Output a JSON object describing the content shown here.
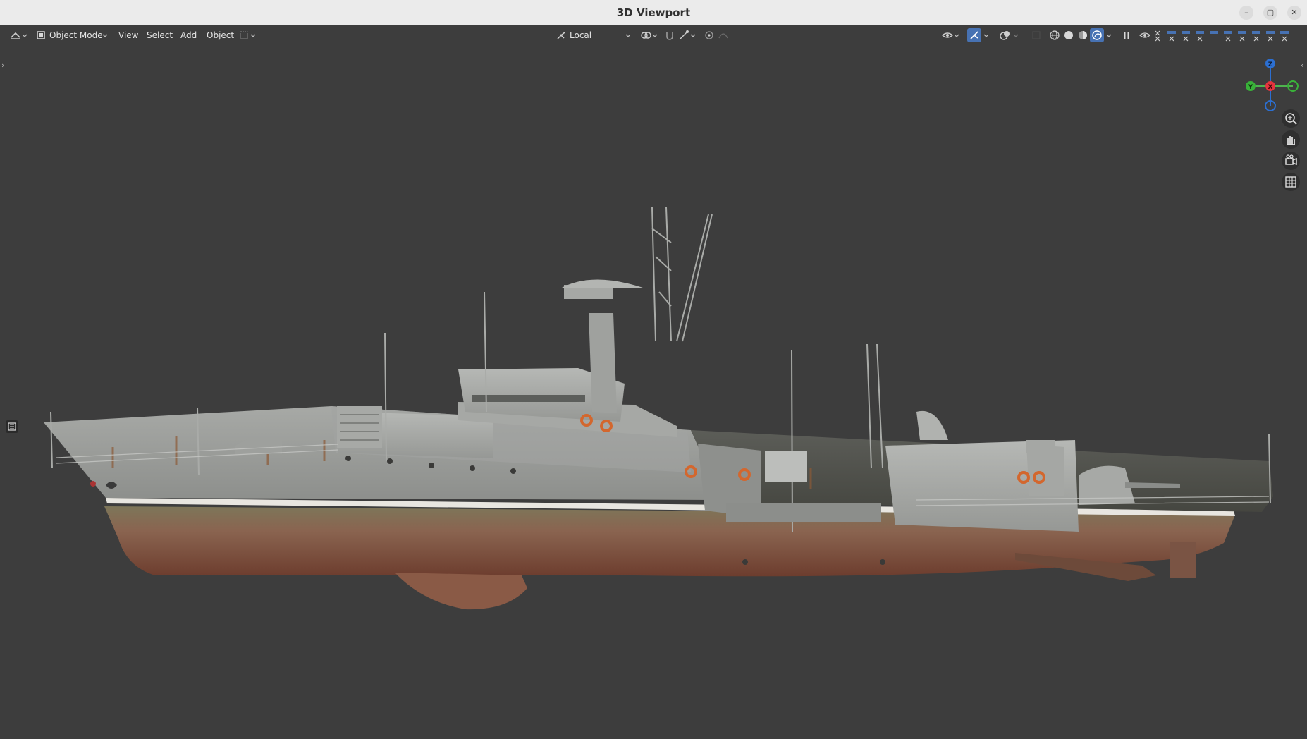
{
  "window": {
    "title": "3D Viewport",
    "controls": {
      "minimize": "–",
      "maximize": "▢",
      "close": "✕"
    }
  },
  "header": {
    "editor_type_icon": "viewport-editor-icon",
    "mode_label": "Object Mode",
    "menus": [
      "View",
      "Select",
      "Add",
      "Object"
    ],
    "transform_orientation": "Local",
    "icons": [
      "pivot-icon",
      "snap-icon",
      "proportional-edit-icon",
      "visibility-icon",
      "gizmo-icon",
      "overlay-icon",
      "xray-icon",
      "wireframe-shading-icon",
      "solid-shading-icon",
      "material-shading-icon",
      "rendered-shading-icon"
    ],
    "accent_color": "#4772b3"
  },
  "viewport": {
    "background": "#3d3d3d",
    "gizmo": {
      "z": "Z",
      "y": "Y",
      "x": "X"
    },
    "nav_buttons": [
      "zoom-icon",
      "pan-hand-icon",
      "camera-view-icon",
      "ortho-grid-icon"
    ]
  }
}
